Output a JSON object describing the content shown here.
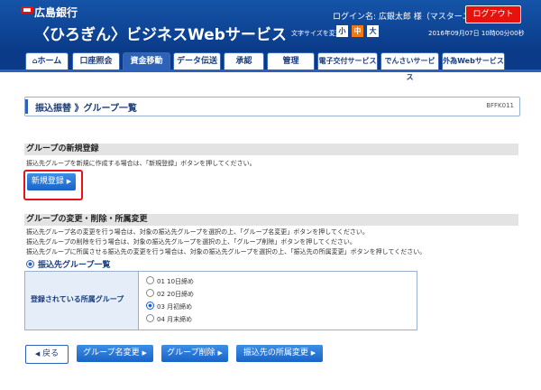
{
  "header": {
    "bank_name": "広島銀行",
    "service_name": "〈ひろぎん〉ビジネスWebサービス",
    "login_label": "ログイン名: 広銀太郎 様（マスターユーザ）",
    "logout_label": "ログアウト",
    "font_size_label": "文字サイズを変更",
    "font_small": "小",
    "font_medium": "中",
    "font_large": "大",
    "datetime": "2016年09月07日 10時00分00秒"
  },
  "nav": {
    "items": [
      {
        "label": "ホーム"
      },
      {
        "label": "口座照会"
      },
      {
        "label": "資金移動"
      },
      {
        "label": "データ伝送"
      },
      {
        "label": "承認"
      },
      {
        "label": "管理"
      },
      {
        "label": "電子交付サービス"
      },
      {
        "label": "でんさいサービス"
      },
      {
        "label": "外為Webサービス"
      }
    ]
  },
  "breadcrumb": {
    "text": "振込振替 》グループ一覧",
    "screen_id": "BFFK011"
  },
  "new_group": {
    "title": "グループの新規登録",
    "description": "振込先グループを新規に作成する場合は、「新規登録」ボタンを押してください。",
    "button": "新規登録"
  },
  "edit_group": {
    "title": "グループの変更・削除・所属変更",
    "desc1": "振込先グループ名の変更を行う場合は、対象の振込先グループを選択の上、「グループ名変更」ボタンを押してください。",
    "desc2": "振込先グループの削除を行う場合は、対象の振込先グループを選択の上、「グループ削除」ボタンを押してください。",
    "desc3": "振込先グループに所属させる振込先の変更を行う場合は、対象の振込先グループを選択の上、「振込先の所属変更」ボタンを押してください。",
    "list_title": "振込先グループ一覧",
    "table_label": "登録されている所属グループ",
    "options": [
      {
        "label": "01 10日締め",
        "selected": false
      },
      {
        "label": "02 20日締め",
        "selected": false
      },
      {
        "label": "03 月初締め",
        "selected": true
      },
      {
        "label": "04 月末締め",
        "selected": false
      }
    ]
  },
  "footer": {
    "back": "戻る",
    "rename": "グループ名変更",
    "delete": "グループ削除",
    "change": "振込先の所属変更"
  },
  "colors": {
    "header_blue": "#0a3a88",
    "button_blue": "#1a63c8",
    "logout_red": "#e8120c",
    "highlight_red": "#e4121b"
  }
}
